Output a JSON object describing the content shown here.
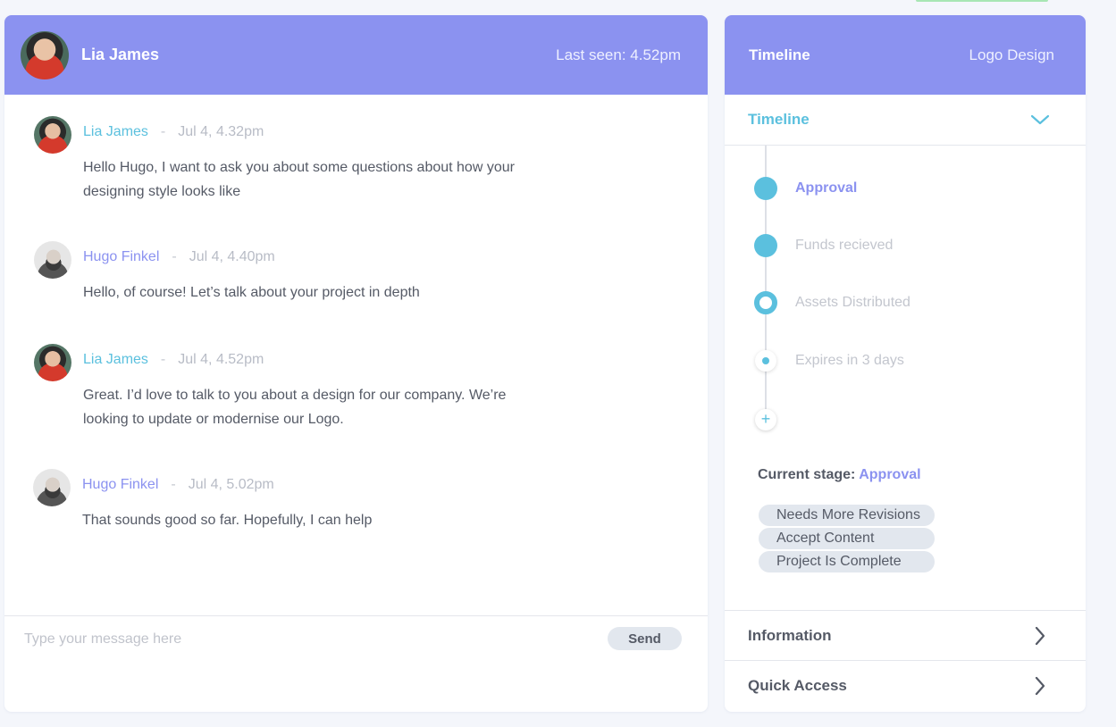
{
  "chat": {
    "contact_name": "Lia James",
    "last_seen": "Last seen: 4.52pm",
    "messages": [
      {
        "author": "Lia James",
        "time": "Jul 4, 4.32pm",
        "text": "Hello Hugo, I want to ask you about some questions about how your designing style looks like",
        "who": "lia"
      },
      {
        "author": "Hugo Finkel",
        "time": "Jul 4, 4.40pm",
        "text": "Hello, of course! Let’s talk about your project in depth",
        "who": "hugo"
      },
      {
        "author": "Lia James",
        "time": "Jul 4, 4.52pm",
        "text": "Great. I’d love to talk to you about a design for our  company. We’re looking to update or modernise our Logo.",
        "who": "lia"
      },
      {
        "author": "Hugo Finkel",
        "time": "Jul 4, 5.02pm",
        "text": "That sounds good so far. Hopefully, I can help",
        "who": "hugo"
      }
    ],
    "separator": "-",
    "composer_placeholder": "Type your message here",
    "send_label": "Send"
  },
  "side": {
    "header_title": "Timeline",
    "project_name": "Logo Design",
    "timeline_section_label": "Timeline",
    "steps": [
      {
        "label": "Approval"
      },
      {
        "label": "Funds recieved"
      },
      {
        "label": "Assets Distributed"
      },
      {
        "label": "Expires in 3 days"
      }
    ],
    "add_icon": "+",
    "current_stage_label": "Current stage:",
    "current_stage_value": "Approval",
    "actions": [
      "Needs More Revisions",
      "Accept Content",
      "Project Is Complete"
    ],
    "information_label": "Information",
    "quick_access_label": "Quick Access"
  },
  "colors": {
    "header": "#8b92f0",
    "accent_blue": "#5bc0de",
    "accent_purple": "#8b92f0"
  },
  "icons": [
    "avatar",
    "chevron-down-icon",
    "chevron-right-icon",
    "plus-icon"
  ]
}
